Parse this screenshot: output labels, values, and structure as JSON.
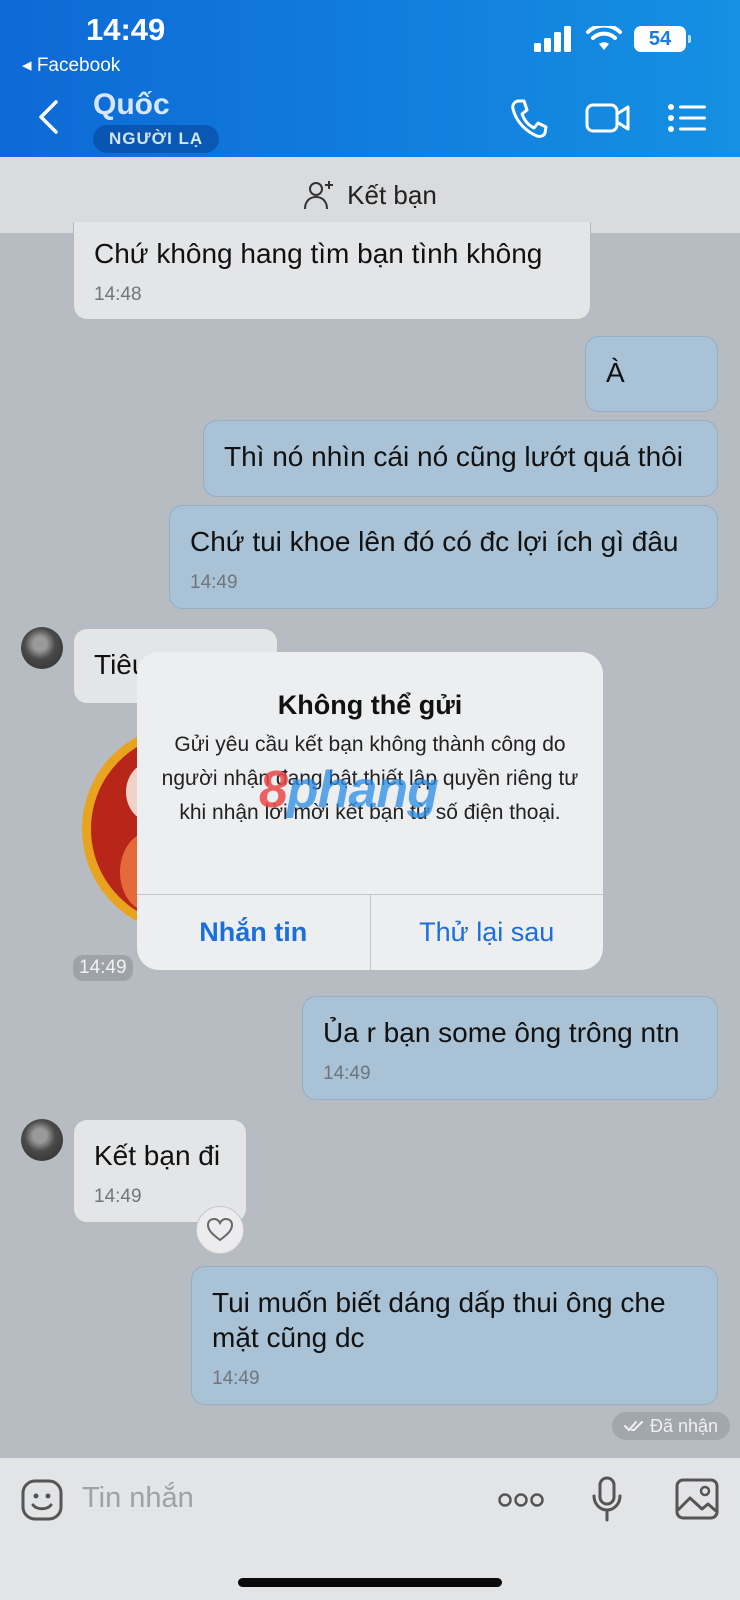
{
  "status_bar": {
    "time": "14:49",
    "back_app": "◂ Facebook",
    "battery": "54"
  },
  "header": {
    "contact_name": "Quốc",
    "badge": "NGƯỜI LẠ",
    "icons": [
      "back-chevron-icon",
      "phone-icon",
      "video-camera-icon",
      "menu-list-icon"
    ]
  },
  "add_friend": {
    "label": "Kết bạn",
    "icon": "add-user-icon"
  },
  "messages": [
    {
      "side": "in",
      "text": "Chứ không hang tìm bạn tình không",
      "time": "14:48"
    },
    {
      "side": "out",
      "text": "À",
      "time": ""
    },
    {
      "side": "out",
      "text": "Thì nó nhìn cái nó cũng lướt quá thôi",
      "time": ""
    },
    {
      "side": "out",
      "text": "Chứ tui khoe lên đó có đc lợi ích gì đâu",
      "time": "14:49"
    },
    {
      "side": "in",
      "text": "Tiêu",
      "time": ""
    },
    {
      "side": "in",
      "type": "sticker",
      "time": "14:49"
    },
    {
      "side": "out",
      "text": "Ủa r bạn some ông trông ntn",
      "time": "14:49"
    },
    {
      "side": "in",
      "text": "Kết bạn đi",
      "time": "14:49"
    },
    {
      "side": "out",
      "text": "Tui muốn biết dáng dấp thui ông che mặt cũng dc",
      "time": "14:49"
    }
  ],
  "received_status": "Đã nhận",
  "alert": {
    "title": "Không thể gửi",
    "message": "Gửi yêu cầu kết bạn không thành công do người nhận đang bật thiết lập quyền riêng tư khi nhận lời mời kết bạn từ số điện thoại.",
    "primary_button": "Nhắn tin",
    "secondary_button": "Thử lại sau",
    "watermark_a": "8",
    "watermark_b": "phang"
  },
  "input": {
    "placeholder": "Tin nhắn"
  },
  "colors": {
    "header": "#1590e3",
    "bubble_out": "#a9c2d6",
    "bubble_in": "#e4e5e7",
    "accent": "#1a6fdb"
  }
}
